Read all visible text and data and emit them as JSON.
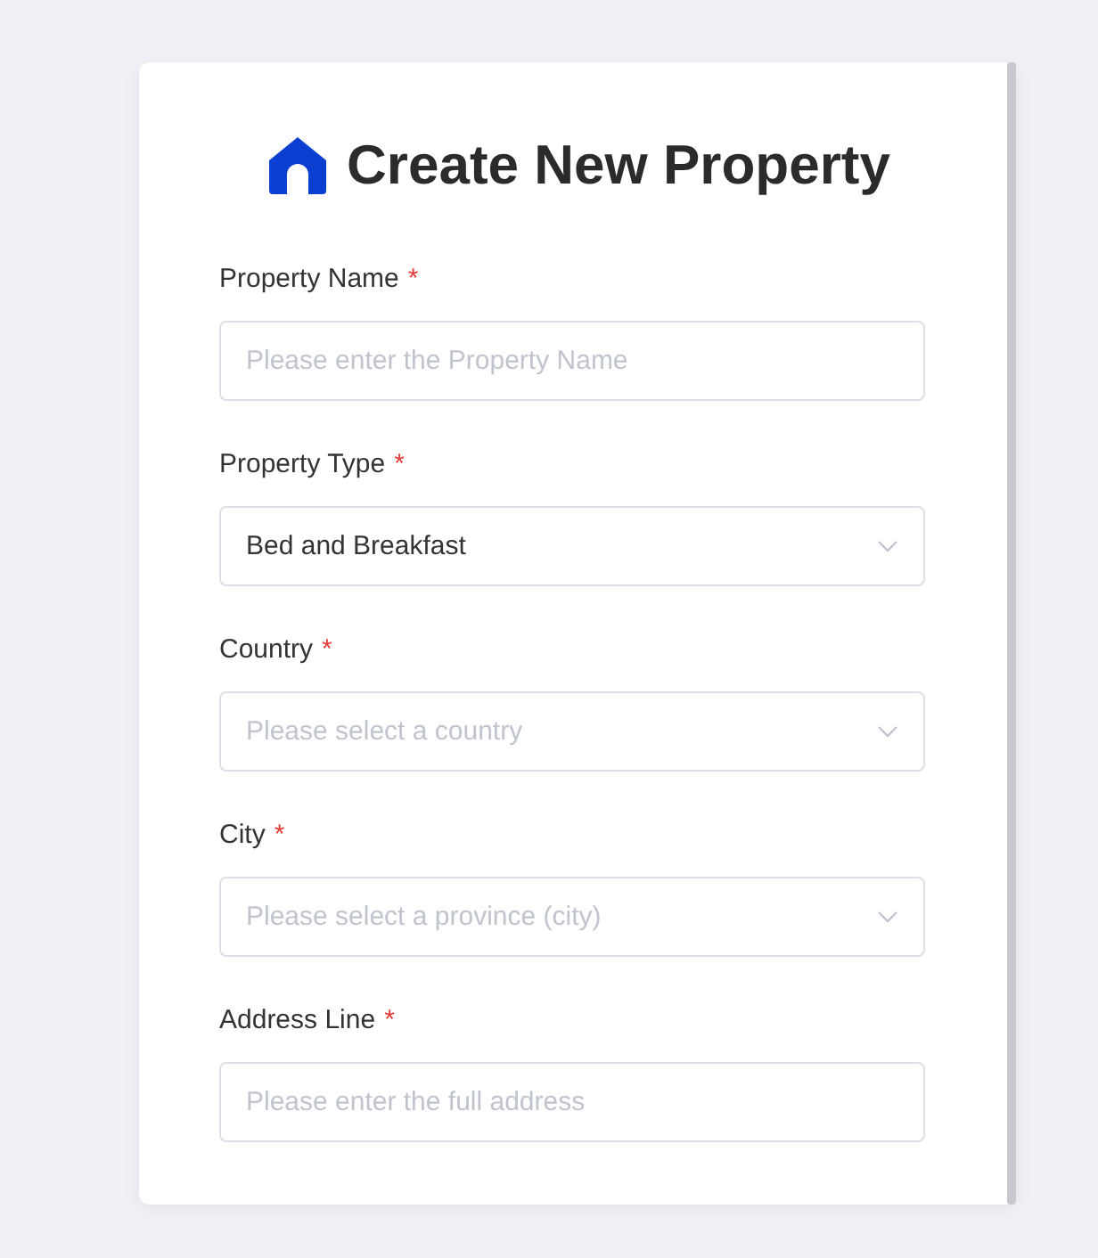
{
  "title": "Create New Property",
  "fields": [
    {
      "kind": "text",
      "label": "Property Name",
      "required_mark": "*",
      "placeholder": "Please enter the Property Name"
    },
    {
      "kind": "select",
      "label": "Property Type",
      "required_mark": "*",
      "value": "Bed and Breakfast"
    },
    {
      "kind": "select",
      "label": "Country",
      "required_mark": "*",
      "placeholder": "Please select a country"
    },
    {
      "kind": "select",
      "label": "City",
      "required_mark": "*",
      "placeholder": "Please select a province (city)"
    },
    {
      "kind": "text",
      "label": "Address Line",
      "required_mark": "*",
      "placeholder": "Please enter the full address"
    }
  ]
}
